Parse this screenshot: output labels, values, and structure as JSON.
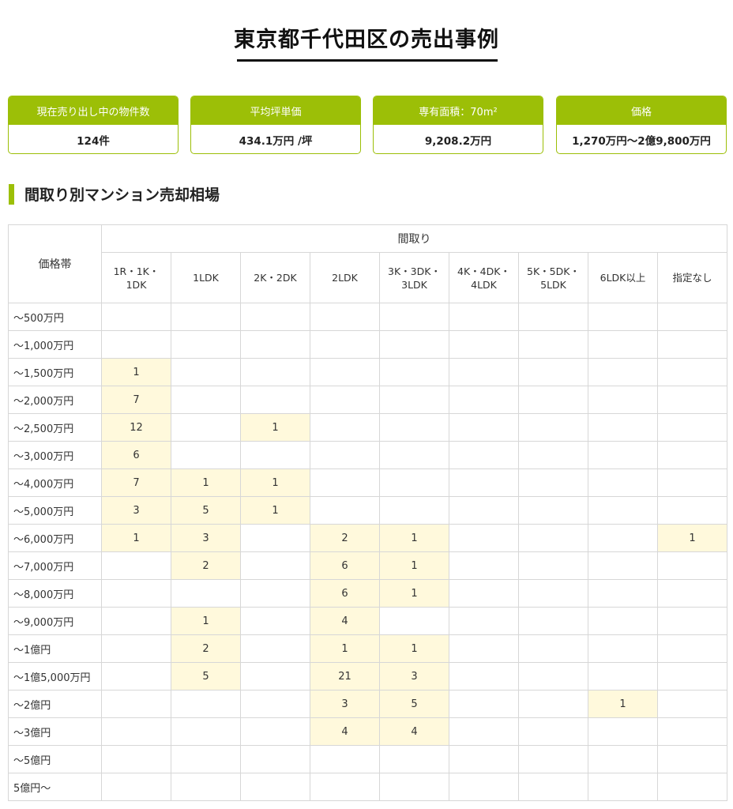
{
  "page": {
    "title": "東京都千代田区の売出事例"
  },
  "stats": [
    {
      "label": "現在売り出し中の物件数",
      "value": "124件"
    },
    {
      "label": "平均坪単価",
      "value": "434.1万円 /坪"
    },
    {
      "label": "専有面積：70m²",
      "value": "9,208.2万円"
    },
    {
      "label": "価格",
      "value": "1,270万円〜2億9,800万円"
    }
  ],
  "section": {
    "title": "間取り別マンション売却相場"
  },
  "table": {
    "corner_label": "価格帯",
    "group_label": "間取り",
    "columns": [
      "1R・1K・1DK",
      "1LDK",
      "2K・2DK",
      "2LDK",
      "3K・3DK・3LDK",
      "4K・4DK・4LDK",
      "5K・5DK・5LDK",
      "6LDK以上",
      "指定なし"
    ],
    "rows": [
      {
        "label": "〜500万円",
        "cells": [
          "",
          "",
          "",
          "",
          "",
          "",
          "",
          "",
          ""
        ]
      },
      {
        "label": "〜1,000万円",
        "cells": [
          "",
          "",
          "",
          "",
          "",
          "",
          "",
          "",
          ""
        ]
      },
      {
        "label": "〜1,500万円",
        "cells": [
          "1",
          "",
          "",
          "",
          "",
          "",
          "",
          "",
          ""
        ]
      },
      {
        "label": "〜2,000万円",
        "cells": [
          "7",
          "",
          "",
          "",
          "",
          "",
          "",
          "",
          ""
        ]
      },
      {
        "label": "〜2,500万円",
        "cells": [
          "12",
          "",
          "1",
          "",
          "",
          "",
          "",
          "",
          ""
        ]
      },
      {
        "label": "〜3,000万円",
        "cells": [
          "6",
          "",
          "",
          "",
          "",
          "",
          "",
          "",
          ""
        ]
      },
      {
        "label": "〜4,000万円",
        "cells": [
          "7",
          "1",
          "1",
          "",
          "",
          "",
          "",
          "",
          ""
        ]
      },
      {
        "label": "〜5,000万円",
        "cells": [
          "3",
          "5",
          "1",
          "",
          "",
          "",
          "",
          "",
          ""
        ]
      },
      {
        "label": "〜6,000万円",
        "cells": [
          "1",
          "3",
          "",
          "2",
          "1",
          "",
          "",
          "",
          "1"
        ]
      },
      {
        "label": "〜7,000万円",
        "cells": [
          "",
          "2",
          "",
          "6",
          "1",
          "",
          "",
          "",
          ""
        ]
      },
      {
        "label": "〜8,000万円",
        "cells": [
          "",
          "",
          "",
          "6",
          "1",
          "",
          "",
          "",
          ""
        ]
      },
      {
        "label": "〜9,000万円",
        "cells": [
          "",
          "1",
          "",
          "4",
          "",
          "",
          "",
          "",
          ""
        ]
      },
      {
        "label": "〜1億円",
        "cells": [
          "",
          "2",
          "",
          "1",
          "1",
          "",
          "",
          "",
          ""
        ]
      },
      {
        "label": "〜1億5,000万円",
        "cells": [
          "",
          "5",
          "",
          "21",
          "3",
          "",
          "",
          "",
          ""
        ]
      },
      {
        "label": "〜2億円",
        "cells": [
          "",
          "",
          "",
          "3",
          "5",
          "",
          "",
          "1",
          ""
        ]
      },
      {
        "label": "〜3億円",
        "cells": [
          "",
          "",
          "",
          "4",
          "4",
          "",
          "",
          "",
          ""
        ]
      },
      {
        "label": "〜5億円",
        "cells": [
          "",
          "",
          "",
          "",
          "",
          "",
          "",
          "",
          ""
        ]
      },
      {
        "label": "5億円〜",
        "cells": [
          "",
          "",
          "",
          "",
          "",
          "",
          "",
          "",
          ""
        ]
      }
    ]
  },
  "colors": {
    "accent": "#9cbf07",
    "highlight": "#fff9dc",
    "border": "#d7d7d7"
  }
}
